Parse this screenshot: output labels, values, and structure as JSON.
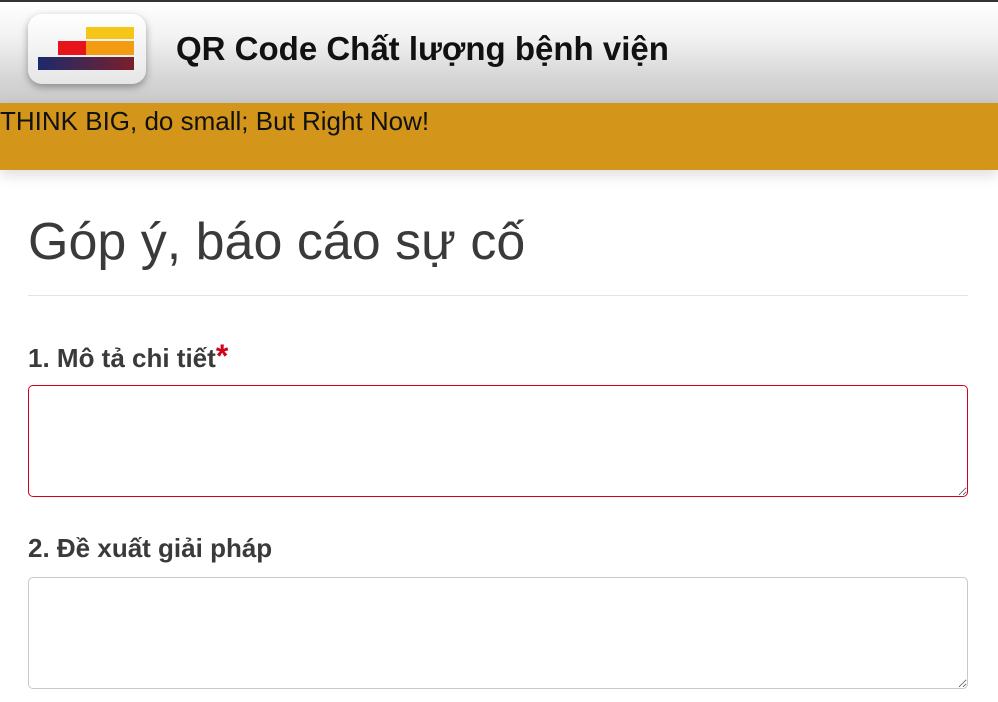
{
  "header": {
    "app_title": "QR Code Chất lượng bệnh viện",
    "logo_icon": "stacked-bars-logo-icon"
  },
  "banner": {
    "slogan": "THINK BIG, do small; But Right Now!",
    "color": "#d4951b"
  },
  "form": {
    "title": "Góp ý, báo cáo sự cố",
    "fields": [
      {
        "label": "1. Mô tả chi tiết",
        "required_mark": "*",
        "value": "",
        "placeholder": ""
      },
      {
        "label": "2. Đề xuất giải pháp",
        "value": "",
        "placeholder": ""
      }
    ]
  },
  "colors": {
    "required": "#d0021b",
    "title_text": "#3a3a3a"
  }
}
